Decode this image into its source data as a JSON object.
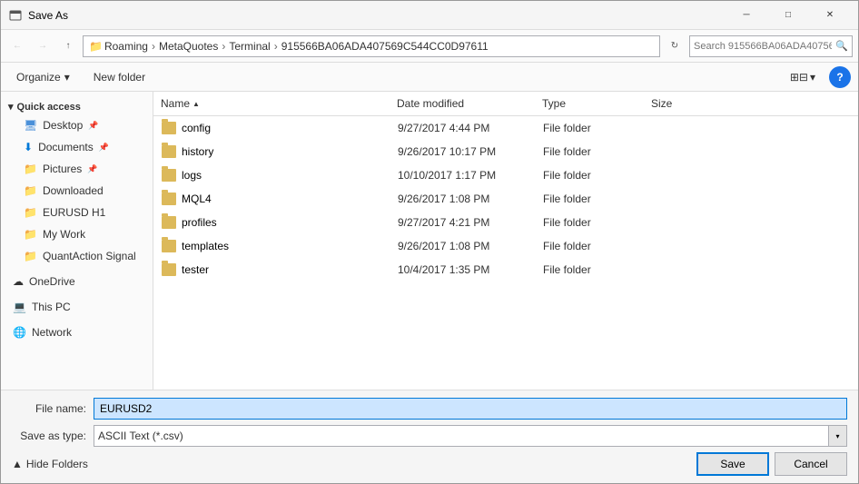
{
  "titleBar": {
    "title": "Save As",
    "closeLabel": "✕",
    "minLabel": "─",
    "maxLabel": "□"
  },
  "addressBar": {
    "pathSegments": [
      "Roaming",
      "MetaQuotes",
      "Terminal",
      "915566BA06ADA407569C544CC0D97611"
    ],
    "searchPlaceholder": "Search 915566BA06ADA40756..."
  },
  "toolbar": {
    "organizeLabel": "Organize",
    "newFolderLabel": "New folder",
    "viewLabel": "⊞⊟",
    "helpLabel": "?"
  },
  "sidebar": {
    "quickAccessLabel": "Quick access",
    "items": [
      {
        "label": "Desktop",
        "pinned": true
      },
      {
        "label": "Documents",
        "pinned": true
      },
      {
        "label": "Pictures",
        "pinned": true
      },
      {
        "label": "Downloaded",
        "pinned": false
      },
      {
        "label": "EURUSD H1",
        "pinned": false
      },
      {
        "label": "My Work",
        "pinned": false
      },
      {
        "label": "QuantAction Signal",
        "pinned": false
      }
    ],
    "oneDriveLabel": "OneDrive",
    "thisPCLabel": "This PC",
    "networkLabel": "Network"
  },
  "fileList": {
    "columns": [
      {
        "label": "Name",
        "sortArrow": "▲"
      },
      {
        "label": "Date modified",
        "sortArrow": ""
      },
      {
        "label": "Type",
        "sortArrow": ""
      },
      {
        "label": "Size",
        "sortArrow": ""
      }
    ],
    "rows": [
      {
        "name": "config",
        "date": "9/27/2017 4:44 PM",
        "type": "File folder",
        "size": ""
      },
      {
        "name": "history",
        "date": "9/26/2017 10:17 PM",
        "type": "File folder",
        "size": ""
      },
      {
        "name": "logs",
        "date": "10/10/2017 1:17 PM",
        "type": "File folder",
        "size": ""
      },
      {
        "name": "MQL4",
        "date": "9/26/2017 1:08 PM",
        "type": "File folder",
        "size": ""
      },
      {
        "name": "profiles",
        "date": "9/27/2017 4:21 PM",
        "type": "File folder",
        "size": ""
      },
      {
        "name": "templates",
        "date": "9/26/2017 1:08 PM",
        "type": "File folder",
        "size": ""
      },
      {
        "name": "tester",
        "date": "10/4/2017 1:35 PM",
        "type": "File folder",
        "size": ""
      }
    ]
  },
  "bottomBar": {
    "fileNameLabel": "File name:",
    "fileNameValue": "EURUSD2",
    "saveAsTypeLabel": "Save as type:",
    "saveAsTypeValue": "ASCII Text (*.csv)",
    "hideFoldersLabel": "Hide Folders",
    "saveLabel": "Save",
    "cancelLabel": "Cancel"
  }
}
